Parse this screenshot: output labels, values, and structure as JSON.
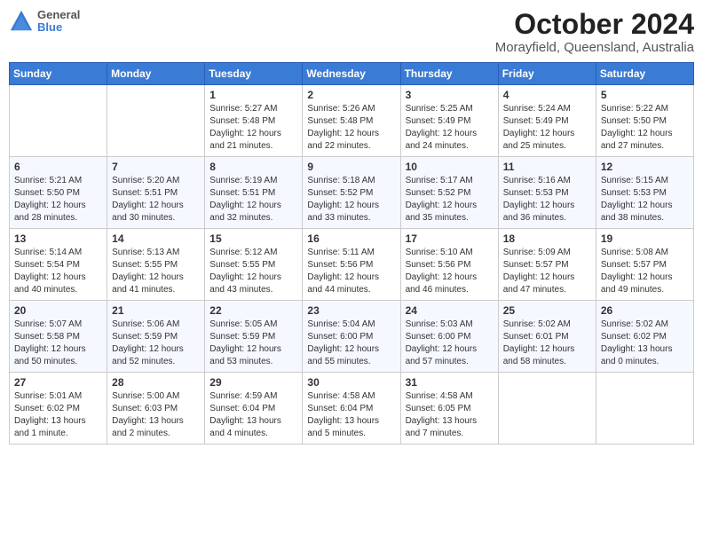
{
  "header": {
    "logo": {
      "general": "General",
      "blue": "Blue"
    },
    "title": "October 2024",
    "location": "Morayfield, Queensland, Australia"
  },
  "weekdays": [
    "Sunday",
    "Monday",
    "Tuesday",
    "Wednesday",
    "Thursday",
    "Friday",
    "Saturday"
  ],
  "weeks": [
    [
      {
        "day": "",
        "sunrise": "",
        "sunset": "",
        "daylight": ""
      },
      {
        "day": "",
        "sunrise": "",
        "sunset": "",
        "daylight": ""
      },
      {
        "day": "1",
        "sunrise": "Sunrise: 5:27 AM",
        "sunset": "Sunset: 5:48 PM",
        "daylight": "Daylight: 12 hours and 21 minutes."
      },
      {
        "day": "2",
        "sunrise": "Sunrise: 5:26 AM",
        "sunset": "Sunset: 5:48 PM",
        "daylight": "Daylight: 12 hours and 22 minutes."
      },
      {
        "day": "3",
        "sunrise": "Sunrise: 5:25 AM",
        "sunset": "Sunset: 5:49 PM",
        "daylight": "Daylight: 12 hours and 24 minutes."
      },
      {
        "day": "4",
        "sunrise": "Sunrise: 5:24 AM",
        "sunset": "Sunset: 5:49 PM",
        "daylight": "Daylight: 12 hours and 25 minutes."
      },
      {
        "day": "5",
        "sunrise": "Sunrise: 5:22 AM",
        "sunset": "Sunset: 5:50 PM",
        "daylight": "Daylight: 12 hours and 27 minutes."
      }
    ],
    [
      {
        "day": "6",
        "sunrise": "Sunrise: 5:21 AM",
        "sunset": "Sunset: 5:50 PM",
        "daylight": "Daylight: 12 hours and 28 minutes."
      },
      {
        "day": "7",
        "sunrise": "Sunrise: 5:20 AM",
        "sunset": "Sunset: 5:51 PM",
        "daylight": "Daylight: 12 hours and 30 minutes."
      },
      {
        "day": "8",
        "sunrise": "Sunrise: 5:19 AM",
        "sunset": "Sunset: 5:51 PM",
        "daylight": "Daylight: 12 hours and 32 minutes."
      },
      {
        "day": "9",
        "sunrise": "Sunrise: 5:18 AM",
        "sunset": "Sunset: 5:52 PM",
        "daylight": "Daylight: 12 hours and 33 minutes."
      },
      {
        "day": "10",
        "sunrise": "Sunrise: 5:17 AM",
        "sunset": "Sunset: 5:52 PM",
        "daylight": "Daylight: 12 hours and 35 minutes."
      },
      {
        "day": "11",
        "sunrise": "Sunrise: 5:16 AM",
        "sunset": "Sunset: 5:53 PM",
        "daylight": "Daylight: 12 hours and 36 minutes."
      },
      {
        "day": "12",
        "sunrise": "Sunrise: 5:15 AM",
        "sunset": "Sunset: 5:53 PM",
        "daylight": "Daylight: 12 hours and 38 minutes."
      }
    ],
    [
      {
        "day": "13",
        "sunrise": "Sunrise: 5:14 AM",
        "sunset": "Sunset: 5:54 PM",
        "daylight": "Daylight: 12 hours and 40 minutes."
      },
      {
        "day": "14",
        "sunrise": "Sunrise: 5:13 AM",
        "sunset": "Sunset: 5:55 PM",
        "daylight": "Daylight: 12 hours and 41 minutes."
      },
      {
        "day": "15",
        "sunrise": "Sunrise: 5:12 AM",
        "sunset": "Sunset: 5:55 PM",
        "daylight": "Daylight: 12 hours and 43 minutes."
      },
      {
        "day": "16",
        "sunrise": "Sunrise: 5:11 AM",
        "sunset": "Sunset: 5:56 PM",
        "daylight": "Daylight: 12 hours and 44 minutes."
      },
      {
        "day": "17",
        "sunrise": "Sunrise: 5:10 AM",
        "sunset": "Sunset: 5:56 PM",
        "daylight": "Daylight: 12 hours and 46 minutes."
      },
      {
        "day": "18",
        "sunrise": "Sunrise: 5:09 AM",
        "sunset": "Sunset: 5:57 PM",
        "daylight": "Daylight: 12 hours and 47 minutes."
      },
      {
        "day": "19",
        "sunrise": "Sunrise: 5:08 AM",
        "sunset": "Sunset: 5:57 PM",
        "daylight": "Daylight: 12 hours and 49 minutes."
      }
    ],
    [
      {
        "day": "20",
        "sunrise": "Sunrise: 5:07 AM",
        "sunset": "Sunset: 5:58 PM",
        "daylight": "Daylight: 12 hours and 50 minutes."
      },
      {
        "day": "21",
        "sunrise": "Sunrise: 5:06 AM",
        "sunset": "Sunset: 5:59 PM",
        "daylight": "Daylight: 12 hours and 52 minutes."
      },
      {
        "day": "22",
        "sunrise": "Sunrise: 5:05 AM",
        "sunset": "Sunset: 5:59 PM",
        "daylight": "Daylight: 12 hours and 53 minutes."
      },
      {
        "day": "23",
        "sunrise": "Sunrise: 5:04 AM",
        "sunset": "Sunset: 6:00 PM",
        "daylight": "Daylight: 12 hours and 55 minutes."
      },
      {
        "day": "24",
        "sunrise": "Sunrise: 5:03 AM",
        "sunset": "Sunset: 6:00 PM",
        "daylight": "Daylight: 12 hours and 57 minutes."
      },
      {
        "day": "25",
        "sunrise": "Sunrise: 5:02 AM",
        "sunset": "Sunset: 6:01 PM",
        "daylight": "Daylight: 12 hours and 58 minutes."
      },
      {
        "day": "26",
        "sunrise": "Sunrise: 5:02 AM",
        "sunset": "Sunset: 6:02 PM",
        "daylight": "Daylight: 13 hours and 0 minutes."
      }
    ],
    [
      {
        "day": "27",
        "sunrise": "Sunrise: 5:01 AM",
        "sunset": "Sunset: 6:02 PM",
        "daylight": "Daylight: 13 hours and 1 minute."
      },
      {
        "day": "28",
        "sunrise": "Sunrise: 5:00 AM",
        "sunset": "Sunset: 6:03 PM",
        "daylight": "Daylight: 13 hours and 2 minutes."
      },
      {
        "day": "29",
        "sunrise": "Sunrise: 4:59 AM",
        "sunset": "Sunset: 6:04 PM",
        "daylight": "Daylight: 13 hours and 4 minutes."
      },
      {
        "day": "30",
        "sunrise": "Sunrise: 4:58 AM",
        "sunset": "Sunset: 6:04 PM",
        "daylight": "Daylight: 13 hours and 5 minutes."
      },
      {
        "day": "31",
        "sunrise": "Sunrise: 4:58 AM",
        "sunset": "Sunset: 6:05 PM",
        "daylight": "Daylight: 13 hours and 7 minutes."
      },
      {
        "day": "",
        "sunrise": "",
        "sunset": "",
        "daylight": ""
      },
      {
        "day": "",
        "sunrise": "",
        "sunset": "",
        "daylight": ""
      }
    ]
  ]
}
